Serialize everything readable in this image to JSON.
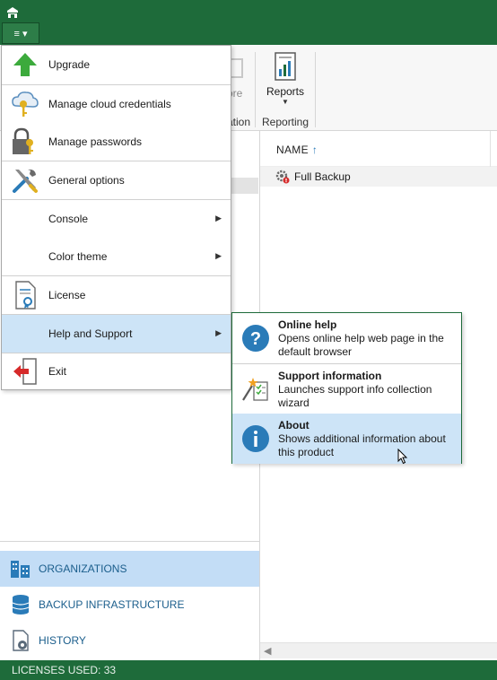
{
  "main_menu": {
    "button_glyph": "≡ ▾",
    "items": [
      {
        "label": "Upgrade",
        "icon": "upgrade-arrow-icon"
      },
      {
        "label": "Manage cloud credentials",
        "icon": "cloud-key-icon"
      },
      {
        "label": "Manage passwords",
        "icon": "lock-key-icon"
      },
      {
        "label": "General options",
        "icon": "tools-icon"
      },
      {
        "label": "Console",
        "submenu_arrow": "▶"
      },
      {
        "label": "Color theme",
        "submenu_arrow": "▶"
      },
      {
        "label": "License",
        "icon": "license-document-icon"
      },
      {
        "label": "Help and Support",
        "submenu_arrow": "▶"
      },
      {
        "label": "Exit",
        "icon": "exit-door-icon"
      }
    ]
  },
  "help_submenu": {
    "items": [
      {
        "title": "Online help",
        "description": "Opens online help web page in the default browser",
        "icon": "question-circle-icon"
      },
      {
        "title": "Support information",
        "description": "Launches support info collection wizard",
        "icon": "wand-checklist-icon"
      },
      {
        "title": "About",
        "description": "Shows additional information about this product",
        "icon": "info-circle-icon"
      }
    ]
  },
  "ribbon": {
    "faded_button_fragment": "ore",
    "faded_group_fragment": "ation",
    "reports_label": "Reports",
    "reporting_group_label": "Reporting"
  },
  "list": {
    "column_name": "NAME",
    "sort_arrow": "↑",
    "rows": [
      {
        "label": "Full Backup",
        "icon": "backup-job-icon"
      }
    ]
  },
  "nav": {
    "items": [
      {
        "label": "ORGANIZATIONS",
        "icon": "organizations-icon",
        "active": true
      },
      {
        "label": "BACKUP INFRASTRUCTURE",
        "icon": "database-icon",
        "active": false
      },
      {
        "label": "HISTORY",
        "icon": "history-icon",
        "active": false
      }
    ]
  },
  "status": {
    "licenses_used": "LICENSES USED: 33"
  },
  "colors": {
    "brand_green": "#1e6b3a",
    "selection_blue": "#cde4f7",
    "nav_text": "#1b5e8c",
    "info_icon_blue": "#2a7bb8"
  }
}
